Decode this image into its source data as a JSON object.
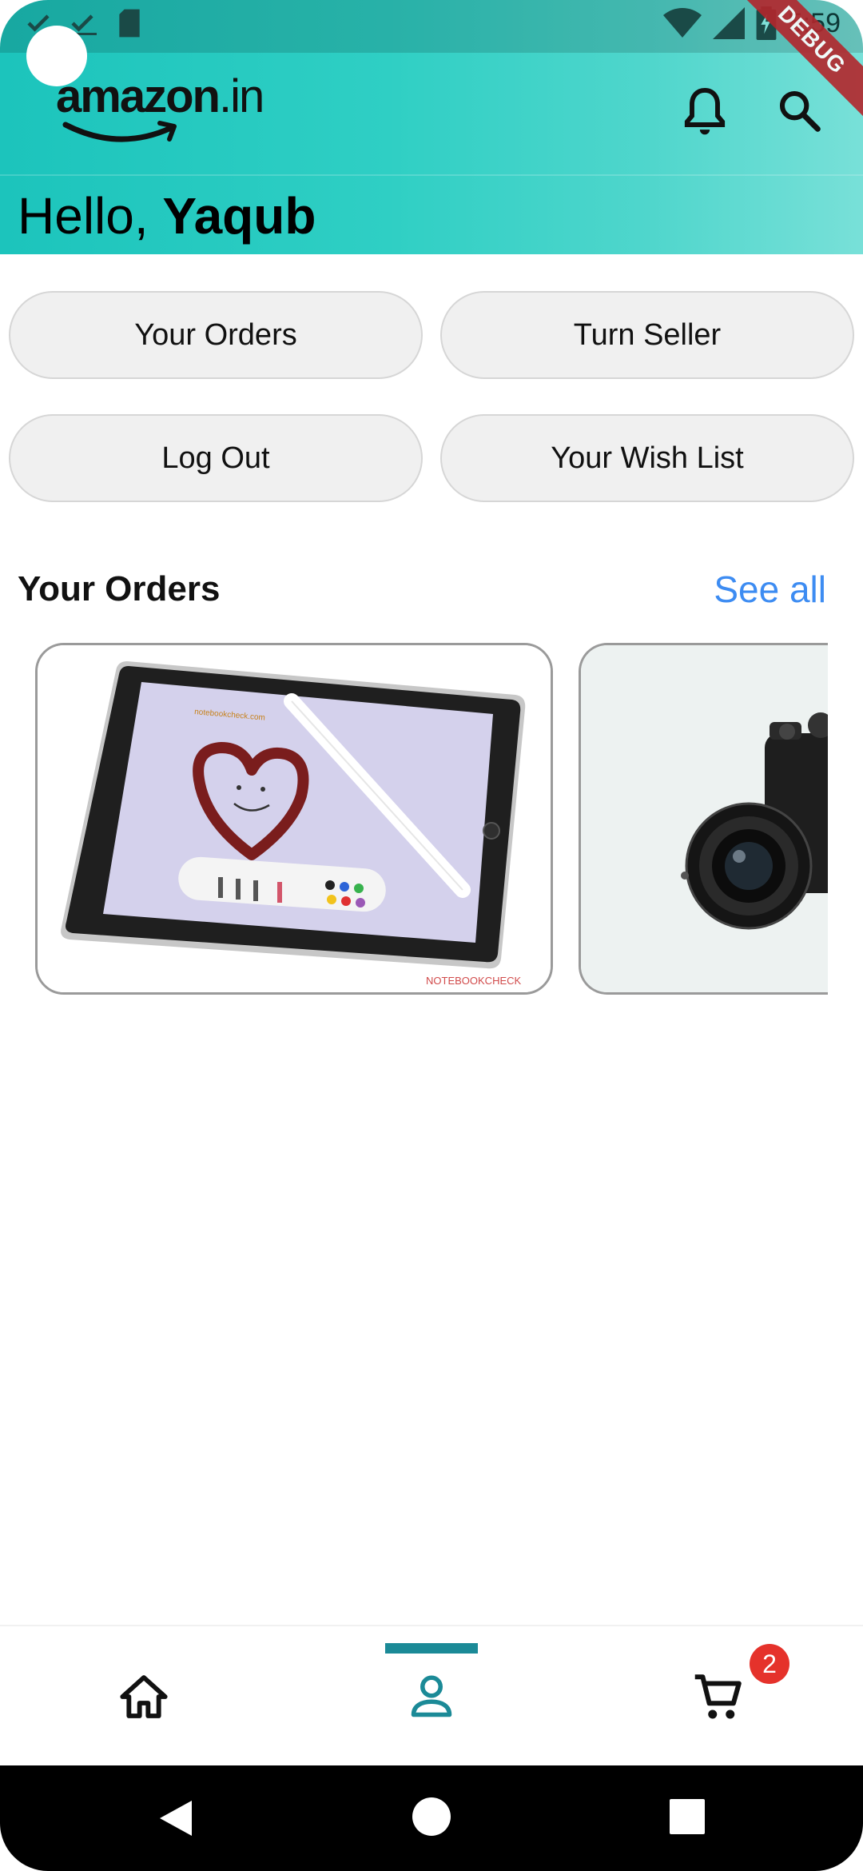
{
  "status_bar": {
    "time": "5:59",
    "left_icons": [
      "check-icon",
      "check-icon",
      "sd-card-icon"
    ],
    "right_icons": [
      "wifi-icon",
      "signal-icon",
      "battery-charging-icon"
    ]
  },
  "debug_banner": "DEBUG",
  "app_bar": {
    "logo_text": "amazon",
    "logo_suffix": ".in",
    "icons": [
      "bell-icon",
      "search-icon"
    ],
    "gradient_colors": [
      "#1cc4bc",
      "#78e0d8"
    ]
  },
  "greeting": {
    "prefix": "Hello, ",
    "name": "Yaqub"
  },
  "actions": [
    {
      "label": "Your Orders"
    },
    {
      "label": "Turn Seller"
    },
    {
      "label": "Log Out"
    },
    {
      "label": "Your Wish List"
    }
  ],
  "orders_section": {
    "title": "Your Orders",
    "see_all": "See all",
    "items": [
      {
        "image": "tablet-with-stylus-image",
        "watermark": "NOTEBOOKCHECK",
        "screen_text": "notebookcheck.com"
      },
      {
        "image": "camera-image"
      }
    ]
  },
  "bottom_nav": {
    "items": [
      "home-icon",
      "account-icon",
      "cart-icon"
    ],
    "active_index": 1,
    "cart_badge": "2",
    "accent_color": "#1b8a97"
  },
  "system_nav": [
    "back-icon",
    "home-circle-icon",
    "recents-icon"
  ],
  "colors": {
    "see_all": "#3d8cf2",
    "badge": "#e5322b"
  }
}
